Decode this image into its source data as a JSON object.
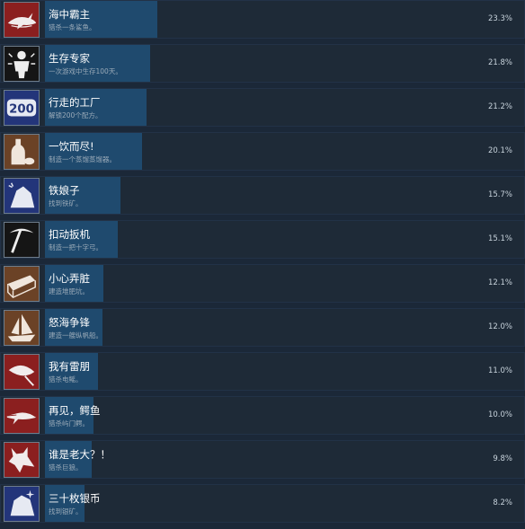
{
  "achievements": [
    {
      "title": "海中霸主",
      "desc": "猎杀一条鲨鱼。",
      "percent": "23.3%",
      "value": 23.3,
      "icon": "shark-icon",
      "icon_bg": "#8b1f1f"
    },
    {
      "title": "生存专家",
      "desc": "一次游戏中生存100天。",
      "percent": "21.8%",
      "value": 21.8,
      "icon": "survivor-icon",
      "icon_bg": "#151515"
    },
    {
      "title": "行走的工厂",
      "desc": "解锁200个配方。",
      "percent": "21.2%",
      "value": 21.2,
      "icon": "200-badge-icon",
      "icon_bg": "#23357a"
    },
    {
      "title": "一饮而尽!",
      "desc": "制造一个蒸馏蒸馏器。",
      "percent": "20.1%",
      "value": 20.1,
      "icon": "bottle-icon",
      "icon_bg": "#6b4226"
    },
    {
      "title": "铁娘子",
      "desc": "找到铁矿。",
      "percent": "15.7%",
      "value": 15.7,
      "icon": "iron-ore-icon",
      "icon_bg": "#23357a"
    },
    {
      "title": "扣动扳机",
      "desc": "制造一把十字弓。",
      "percent": "15.1%",
      "value": 15.1,
      "icon": "pickaxe-icon",
      "icon_bg": "#151515"
    },
    {
      "title": "小心弄脏",
      "desc": "建造堆肥坑。",
      "percent": "12.1%",
      "value": 12.1,
      "icon": "compost-crate-icon",
      "icon_bg": "#6b4226"
    },
    {
      "title": "怒海争锋",
      "desc": "建造一艘纵帆船。",
      "percent": "12.0%",
      "value": 12.0,
      "icon": "sailboat-icon",
      "icon_bg": "#6b4226"
    },
    {
      "title": "我有雷朋",
      "desc": "猎杀电鳐。",
      "percent": "11.0%",
      "value": 11.0,
      "icon": "stingray-icon",
      "icon_bg": "#8b1f1f"
    },
    {
      "title": "再见，鳄鱼",
      "desc": "猎杀屿门鳄。",
      "percent": "10.0%",
      "value": 10.0,
      "icon": "crocodile-icon",
      "icon_bg": "#8b1f1f"
    },
    {
      "title": "谁是老大？！",
      "desc": "猎杀巨狼。",
      "percent": "9.8%",
      "value": 9.8,
      "icon": "wolf-icon",
      "icon_bg": "#8b1f1f"
    },
    {
      "title": "三十枚银币",
      "desc": "找到银矿。",
      "percent": "8.2%",
      "value": 8.2,
      "icon": "silver-ore-icon",
      "icon_bg": "#23357a"
    }
  ]
}
